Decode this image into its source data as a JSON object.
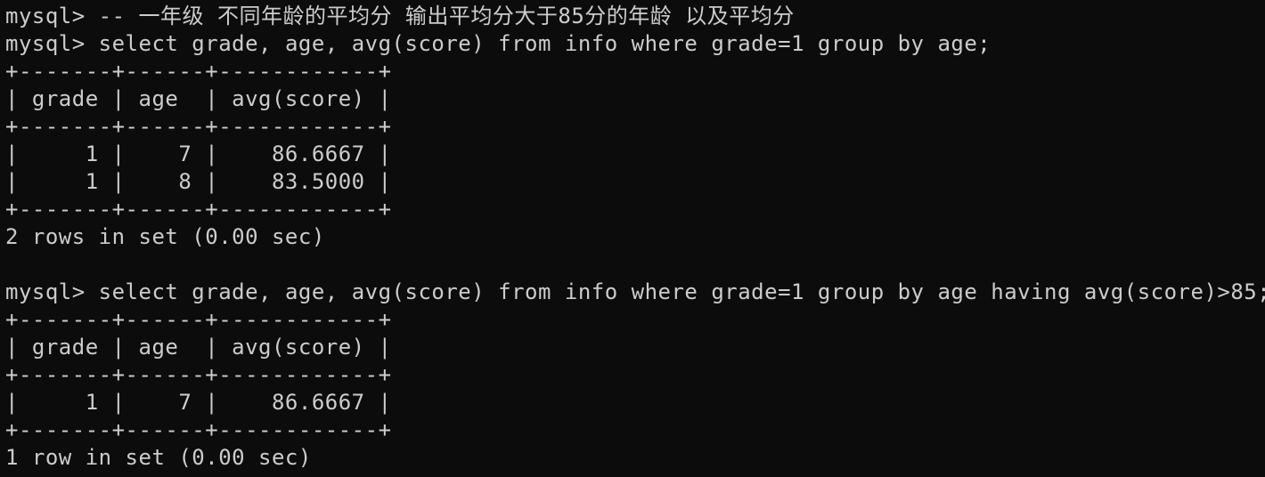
{
  "terminal": {
    "prompt": "mysql> ",
    "comment": "-- 一年级 不同年龄的平均分 输出平均分大于85分的年龄 以及平均分",
    "query1": "select grade, age, avg(score) from info where grade=1 group by age;",
    "query2": "select grade, age, avg(score) from info where grade=1 group by age having avg(score)>85;",
    "result1": {
      "border": "+-------+------+------------+",
      "header": "| grade | age  | avg(score) |",
      "rows": [
        "|     1 |    7 |    86.6667 |",
        "|     1 |    8 |    83.5000 |"
      ],
      "status": "2 rows in set (0.00 sec)"
    },
    "result2": {
      "border": "+-------+------+------------+",
      "header": "| grade | age  | avg(score) |",
      "rows": [
        "|     1 |    7 |    86.6667 |"
      ],
      "status": "1 row in set (0.00 sec)"
    }
  }
}
